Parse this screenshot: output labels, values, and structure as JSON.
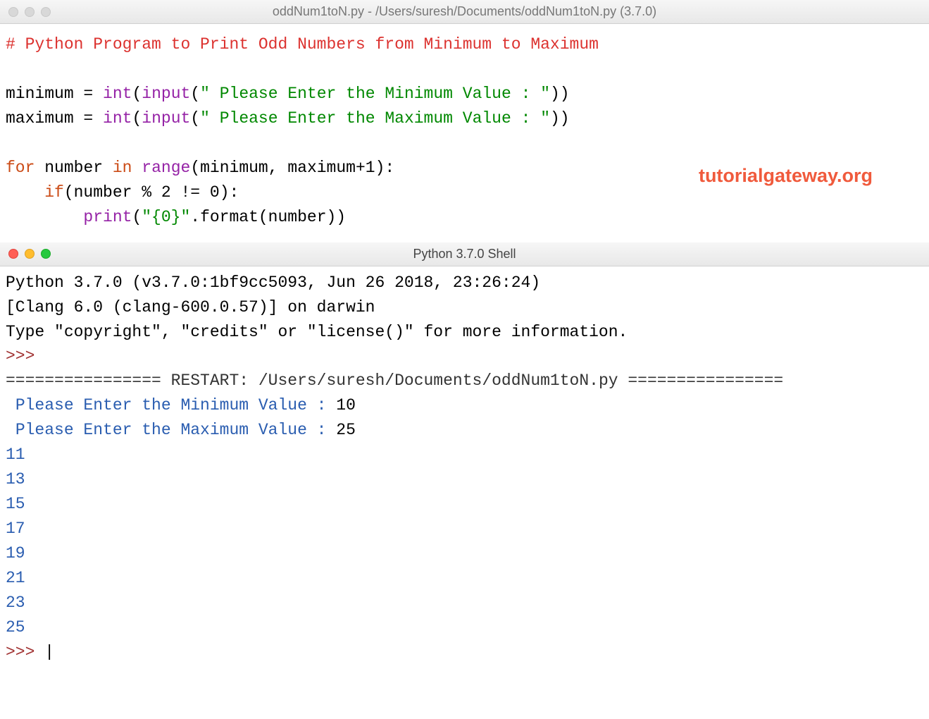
{
  "editor": {
    "title": "oddNum1toN.py - /Users/suresh/Documents/oddNum1toN.py (3.7.0)",
    "watermark": "tutorialgateway.org",
    "code": {
      "comment1": "# Python Program to Print Odd Numbers from Minimum to Maximum",
      "var_min": "minimum",
      "var_max": "maximum",
      "assign": " = ",
      "int_fn": "int",
      "input_fn": "input",
      "open_paren": "(",
      "close_paren": ")",
      "close_paren2": "))",
      "str_min": "\" Please Enter the Minimum Value : \"",
      "str_max": "\" Please Enter the Maximum Value : \"",
      "for_kw": "for",
      "space": " ",
      "number_var": "number",
      "in_kw": "in",
      "range_fn": "range",
      "range_args": "(minimum, maximum+",
      "one": "1",
      "colon_close": "):",
      "indent1": "    ",
      "if_kw": "if",
      "if_cond": "(number % ",
      "two": "2",
      "neq": " != ",
      "zero": "0",
      "indent2": "        ",
      "print_fn": "print",
      "fmt_str": "\"{0}\"",
      "fmt_call": ".format(number))"
    }
  },
  "shell": {
    "title": "Python 3.7.0 Shell",
    "banner1": "Python 3.7.0 (v3.7.0:1bf9cc5093, Jun 26 2018, 23:26:24) ",
    "banner2": "[Clang 6.0 (clang-600.0.57)] on darwin",
    "banner3": "Type \"copyright\", \"credits\" or \"license()\" for more information.",
    "prompt": ">>> ",
    "restart_prefix": "================ ",
    "restart_label": "RESTART: /Users/suresh/Documents/oddNum1toN.py",
    "restart_suffix": " ================",
    "input_min_label": " Please Enter the Minimum Value : ",
    "input_min_val": "10",
    "input_max_label": " Please Enter the Maximum Value : ",
    "input_max_val": "25",
    "outputs": [
      "11",
      "13",
      "15",
      "17",
      "19",
      "21",
      "23",
      "25"
    ],
    "cursor": "|"
  }
}
